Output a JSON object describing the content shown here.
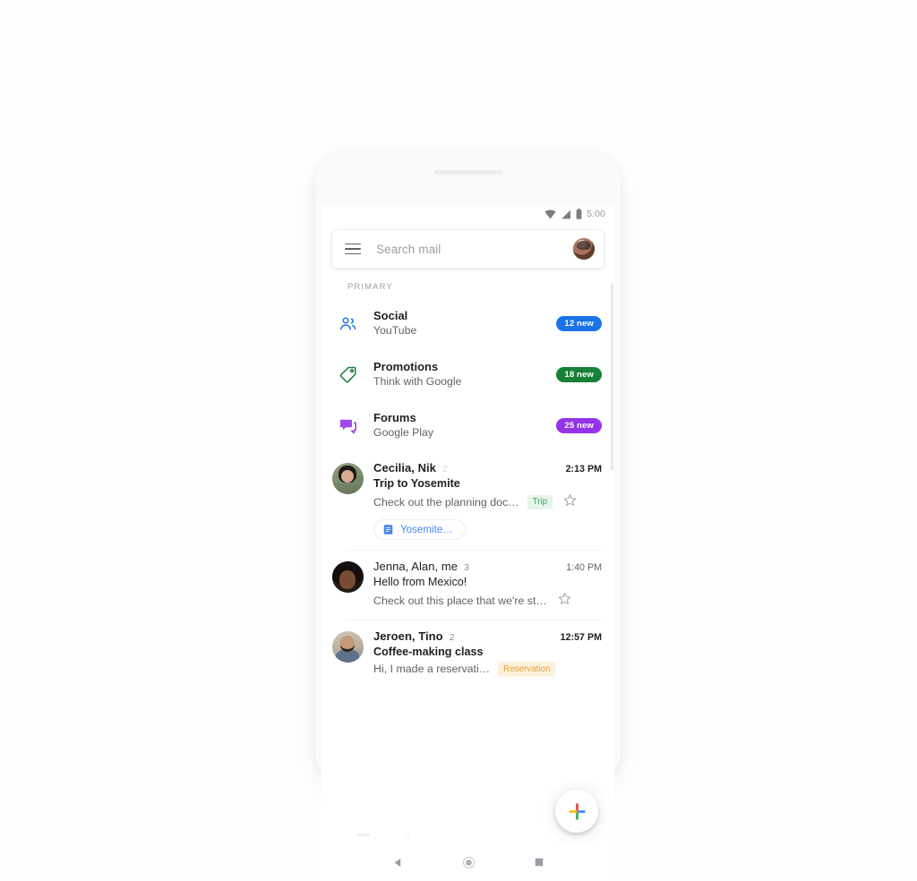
{
  "status_bar": {
    "time": "5:00",
    "icons": [
      "wifi-icon",
      "cell-signal-icon",
      "battery-icon"
    ]
  },
  "search": {
    "placeholder": "Search mail",
    "menu_icon": "hamburger-menu-icon",
    "avatar": "account-avatar"
  },
  "section": {
    "label": "PRIMARY"
  },
  "categories": [
    {
      "icon": "social-people-icon",
      "title": "Social",
      "subtitle": "YouTube",
      "badge": "12 new",
      "color": "#1a73e8"
    },
    {
      "icon": "promotions-tag-icon",
      "title": "Promotions",
      "subtitle": "Think with Google",
      "badge": "18 new",
      "color": "#188038"
    },
    {
      "icon": "forums-chat-icon",
      "title": "Forums",
      "subtitle": "Google Play",
      "badge": "25 new",
      "color": "#9334e6"
    }
  ],
  "emails": [
    {
      "sender": "Cecilia, Nik",
      "count": "2",
      "time": "2:13 PM",
      "subject": "Trip to Yosemite",
      "snippet": "Check out the planning doc…",
      "chip": "Trip",
      "unread": true,
      "starred": false,
      "attachment": {
        "name": "Yosemite…",
        "icon": "google-docs-icon"
      }
    },
    {
      "sender": "Jenna, Alan, me",
      "count": "3",
      "time": "1:40 PM",
      "subject": "Hello from Mexico!",
      "snippet": "Check out this place that we're st…",
      "chip": "",
      "unread": false,
      "starred": false
    },
    {
      "sender": "Jeroen, Tino",
      "count": "2",
      "time": "12:57 PM",
      "subject": "Coffee-making class",
      "snippet": "Hi, I made a reservati…",
      "chip": "Reservation",
      "unread": true,
      "starred": false
    }
  ],
  "fab": {
    "name": "compose-button",
    "icon": "google-plus-icon"
  },
  "nav_bar": {
    "back": "back-button",
    "home": "home-button",
    "recents": "recents-button"
  },
  "colors": {
    "social_blue": "#1a73e8",
    "promotions_green": "#188038",
    "forums_purple": "#9334e6",
    "link_blue": "#4285f4",
    "trip_chip_bg": "#e6f4ea",
    "trip_chip_text": "#34a853",
    "reservation_chip_bg": "#fdf1dc",
    "reservation_chip_text": "#e5a13a"
  }
}
